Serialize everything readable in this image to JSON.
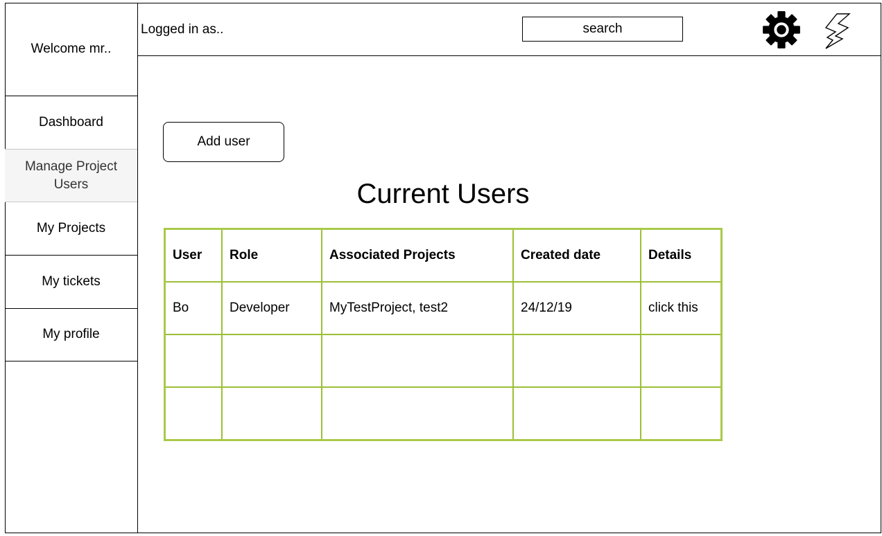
{
  "sidebar": {
    "welcome": "Welcome mr..",
    "items": [
      {
        "label": "Dashboard",
        "active": false
      },
      {
        "label": "Manage Project Users",
        "active": true
      },
      {
        "label": "My Projects",
        "active": false
      },
      {
        "label": "My tickets",
        "active": false
      },
      {
        "label": "My profile",
        "active": false
      }
    ]
  },
  "header": {
    "logged_in": "Logged in as..",
    "search_label": "search",
    "icons": [
      "gear-icon",
      "lightning-icon"
    ]
  },
  "main": {
    "add_user_label": "Add user",
    "title": "Current Users",
    "table": {
      "columns": [
        "User",
        "Role",
        "Associated Projects",
        "Created date",
        "Details"
      ],
      "rows": [
        [
          "Bo",
          "Developer",
          "MyTestProject, test2",
          "24/12/19",
          "click this"
        ],
        [
          "",
          "",
          "",
          "",
          ""
        ],
        [
          "",
          "",
          "",
          "",
          ""
        ]
      ]
    }
  },
  "colors": {
    "table_border": "#9cbf35",
    "active_nav_bg": "#f5f5f5"
  }
}
